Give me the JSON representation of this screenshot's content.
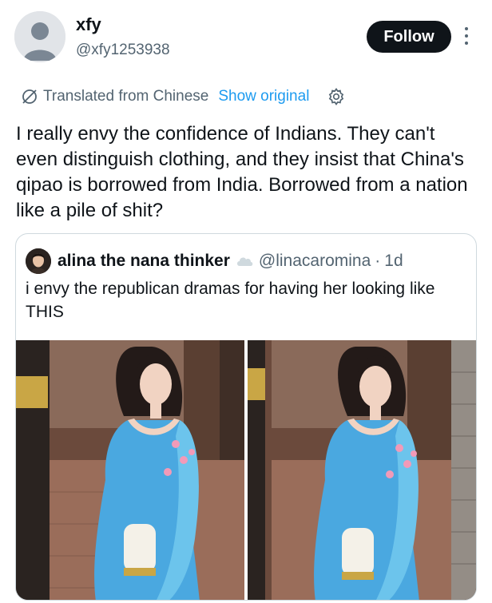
{
  "author": {
    "display_name": "xfy",
    "handle": "@xfy1253938",
    "avatar_icon": "default-profile-icon",
    "follow_label": "Follow"
  },
  "translation": {
    "label": "Translated from Chinese",
    "show_original": "Show original",
    "icon": "translate-slash-icon",
    "settings_icon": "gear-icon"
  },
  "tweet": {
    "text": "I really envy the confidence of Indians. They can't even distinguish clothing, and they insist that China's qipao is borrowed from India. Borrowed from a nation like a pile of shit?"
  },
  "quote": {
    "display_name": "alina the nana thinker",
    "badge_icon": "cloud-icon",
    "handle": "@linacaromina",
    "separator": "·",
    "time": "1d",
    "text": "i envy the republican dramas for having her looking like THIS",
    "images": [
      {
        "icon": "photo-woman-blue-dress"
      },
      {
        "icon": "photo-woman-blue-dress"
      }
    ]
  },
  "colors": {
    "text": "#0f1419",
    "secondary": "#536471",
    "link": "#1d9bf0",
    "border": "#cfd9de",
    "dress_blue": "#4aa8e0"
  }
}
